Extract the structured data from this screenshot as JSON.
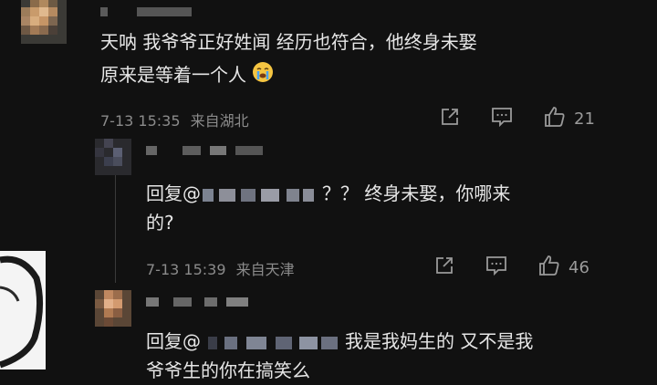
{
  "comments": [
    {
      "text_line1": "天呐 我爷爷正好姓闻 经历也符合，他终身未娶",
      "text_line2": "原来是等着一个人",
      "emoji": "crying-face-emoji",
      "time": "7-13 15:35",
      "location": "来自湖北",
      "likes": "21"
    },
    {
      "reply_prefix": "回复@",
      "text_line1": "？？ 终身未娶，你哪来",
      "text_line2": "的?",
      "time": "7-13 15:39",
      "location": "来自天津",
      "likes": "46"
    },
    {
      "reply_prefix": "回复@",
      "text_line1": "我是我妈生的 又不是我",
      "text_line2": "爷爷生的你在搞笑么"
    }
  ],
  "colors": {
    "background": "#111111",
    "text": "#e6e6e6",
    "meta": "#8b8b8b"
  },
  "icons": [
    "share-icon",
    "comment-icon",
    "thumbs-up-icon"
  ]
}
